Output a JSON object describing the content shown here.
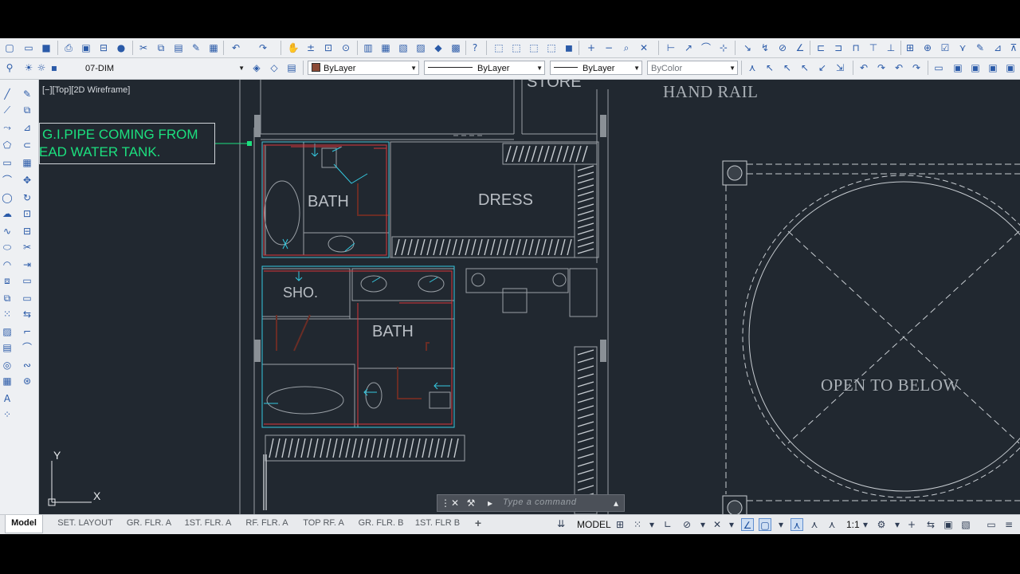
{
  "toolbar": {
    "layer": "07-DIM",
    "color": "ByLayer",
    "linetype": "ByLayer",
    "lineweight": "ByLayer",
    "plotstyle": "ByColor"
  },
  "viewport": {
    "label": "[−][Top][2D Wireframe]"
  },
  "callout": {
    "line1": "G.I.PIPE COMING FROM",
    "line2": "EAD WATER TANK."
  },
  "rooms": {
    "store": "STORE",
    "bath1": "BATH",
    "dress": "DRESS",
    "shower": "SHO.",
    "bath2": "BATH",
    "hand_rail": "HAND RAIL",
    "open_to_below": "OPEN TO BELOW"
  },
  "ucs": {
    "x": "X",
    "y": "Y"
  },
  "command": {
    "placeholder": "Type a command"
  },
  "tabs": [
    {
      "label": "Model",
      "active": true
    },
    {
      "label": "SET. LAYOUT"
    },
    {
      "label": "GR. FLR. A"
    },
    {
      "label": "1ST. FLR. A"
    },
    {
      "label": "RF. FLR. A"
    },
    {
      "label": "TOP RF. A"
    },
    {
      "label": "GR. FLR. B"
    },
    {
      "label": "1ST. FLR B"
    },
    {
      "label": "+"
    }
  ],
  "status": {
    "space": "MODEL",
    "scale": "1:1"
  },
  "colors": {
    "canvas": "#212830",
    "callout_text": "#1ce07f",
    "cyan_lines": "#35c9e0",
    "red_lines": "#d9363a"
  },
  "icons": {
    "toolbar_row1": [
      "new-file-icon",
      "open-file-icon",
      "save-icon",
      "plot-icon",
      "plot-preview-icon",
      "publish-icon",
      "undo-icon",
      "redo-icon",
      "pan-icon",
      "zoom-realtime-icon",
      "zoom-window-icon",
      "help-icon",
      "dimension-icon"
    ],
    "status": [
      "grid-icon",
      "snap-icon",
      "ortho-icon",
      "polar-icon",
      "osnap-icon",
      "dynamic-ucs-icon",
      "annotation-icon",
      "workspace-icon",
      "fullscreen-icon"
    ]
  }
}
